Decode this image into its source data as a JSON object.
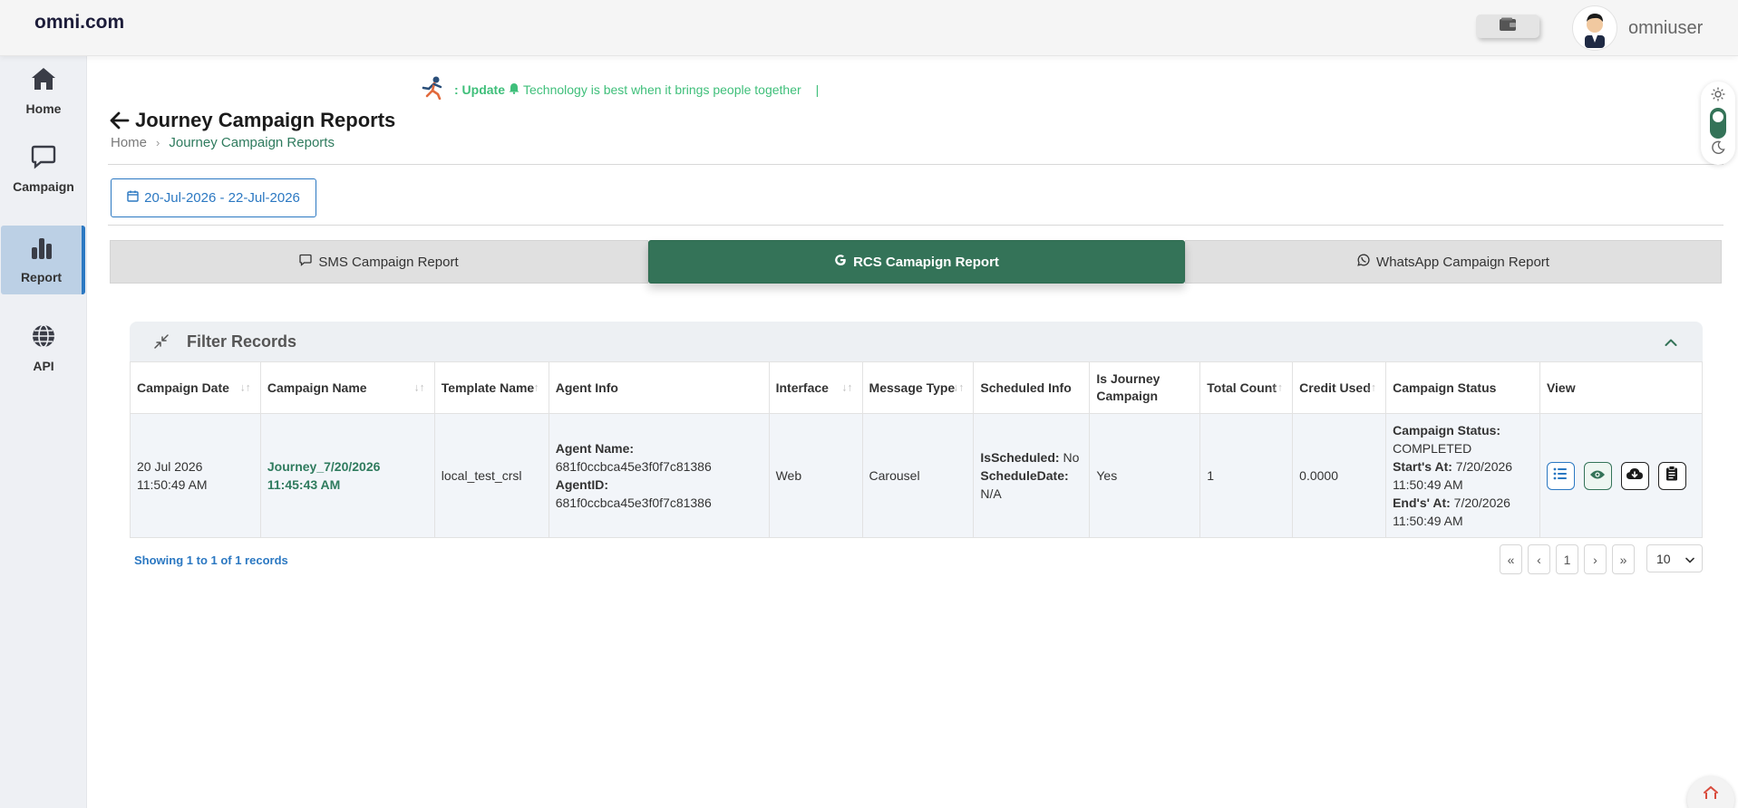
{
  "brand": "omni.com",
  "user": {
    "name": "omniuser"
  },
  "sidebar": {
    "items": [
      {
        "label": "Home"
      },
      {
        "label": "Campaign"
      },
      {
        "label": "Report"
      },
      {
        "label": "API"
      }
    ]
  },
  "ticker": {
    "prefix": ": Update",
    "message": "Technology is best when it brings people together",
    "cursor": "|"
  },
  "page": {
    "title": "Journey Campaign Reports",
    "breadcrumb": {
      "home": "Home",
      "current": "Journey Campaign Reports"
    }
  },
  "date_range": "20-Jul-2026 - 22-Jul-2026",
  "tabs": [
    {
      "label": "SMS Campaign Report"
    },
    {
      "label": "RCS Camapign Report"
    },
    {
      "label": "WhatsApp Campaign Report"
    }
  ],
  "filter": {
    "title": "Filter Records"
  },
  "table": {
    "headers": [
      "Campaign Date",
      "Campaign Name",
      "Template Name",
      "Agent Info",
      "Interface",
      "Message Type",
      "Scheduled Info",
      "Is Journey Campaign",
      "Total Count",
      "Credit Used",
      "Campaign Status",
      "View"
    ],
    "row": {
      "date_line1": "20 Jul 2026",
      "date_line2": "11:50:49 AM",
      "name_line1": "Journey_7/20/2026",
      "name_line2": "11:45:43 AM",
      "template": "local_test_crsl",
      "agent_name_label": "Agent Name:",
      "agent_name": "681f0ccbca45e3f0f7c81386",
      "agent_id_label": "AgentID:",
      "agent_id": "681f0ccbca45e3f0f7c81386",
      "interface": "Web",
      "message_type": "Carousel",
      "is_scheduled_label": "IsScheduled:",
      "is_scheduled": "No",
      "schedule_date_label": "ScheduleDate:",
      "schedule_date": "N/A",
      "is_journey": "Yes",
      "total_count": "1",
      "credit_used": "0.0000",
      "status_label": "Campaign Status:",
      "status": "COMPLETED",
      "starts_label": "Start's At:",
      "starts_date": "7/20/2026",
      "starts_time": "11:50:49 AM",
      "ends_label": "End's' At:",
      "ends_date": "7/20/2026",
      "ends_time": "11:50:49 AM"
    }
  },
  "pagination": {
    "showing": "Showing 1 to 1 of 1 records",
    "first": "«",
    "prev": "‹",
    "current": "1",
    "next": "›",
    "last": "»",
    "per_page": "10"
  },
  "icons": {
    "home": "home-icon",
    "campaign": "chat-bubble-icon",
    "report": "bar-chart-icon",
    "api": "globe-icon",
    "wallet": "wallet-icon",
    "calendar": "calendar-icon",
    "sun": "sun-icon",
    "moon": "moon-icon"
  },
  "colors": {
    "primary_green": "#347358",
    "link_blue": "#2b78c2",
    "ticker_green": "#3fbf7a",
    "sidebar_bg": "#eef0f4"
  }
}
